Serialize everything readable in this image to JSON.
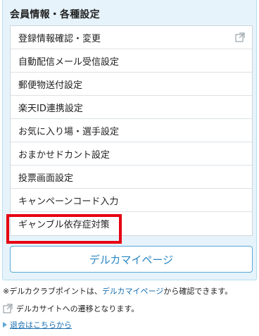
{
  "section": {
    "title": "会員情報・各種設定"
  },
  "menu": {
    "items": [
      {
        "label": "登録情報確認・変更",
        "external": true
      },
      {
        "label": "自動配信メール受信設定"
      },
      {
        "label": "郵便物送付設定"
      },
      {
        "label": "楽天ID連携設定"
      },
      {
        "label": "お気に入り場・選手設定"
      },
      {
        "label": "おまかせドカント設定"
      },
      {
        "label": "投票画面設定"
      },
      {
        "label": "キャンペーンコード入力"
      },
      {
        "label": "ギャンブル依存症対策",
        "highlighted": true
      }
    ]
  },
  "mypage_button": {
    "label": "デルカマイページ"
  },
  "notes": {
    "point_prefix": "※デルカクラブポイントは、",
    "point_link": "デルカマイページ",
    "point_suffix": "から確認できます。",
    "external_site": "デルカサイトへの遷移となります。"
  },
  "withdraw": {
    "label": "退会はこちらから"
  },
  "icons": {
    "external": "external-link-icon",
    "arrow": "triangle-right-icon"
  },
  "colors": {
    "panel_bg": "#e6f3fb",
    "accent": "#2a86c4",
    "highlight": "#e60012"
  }
}
